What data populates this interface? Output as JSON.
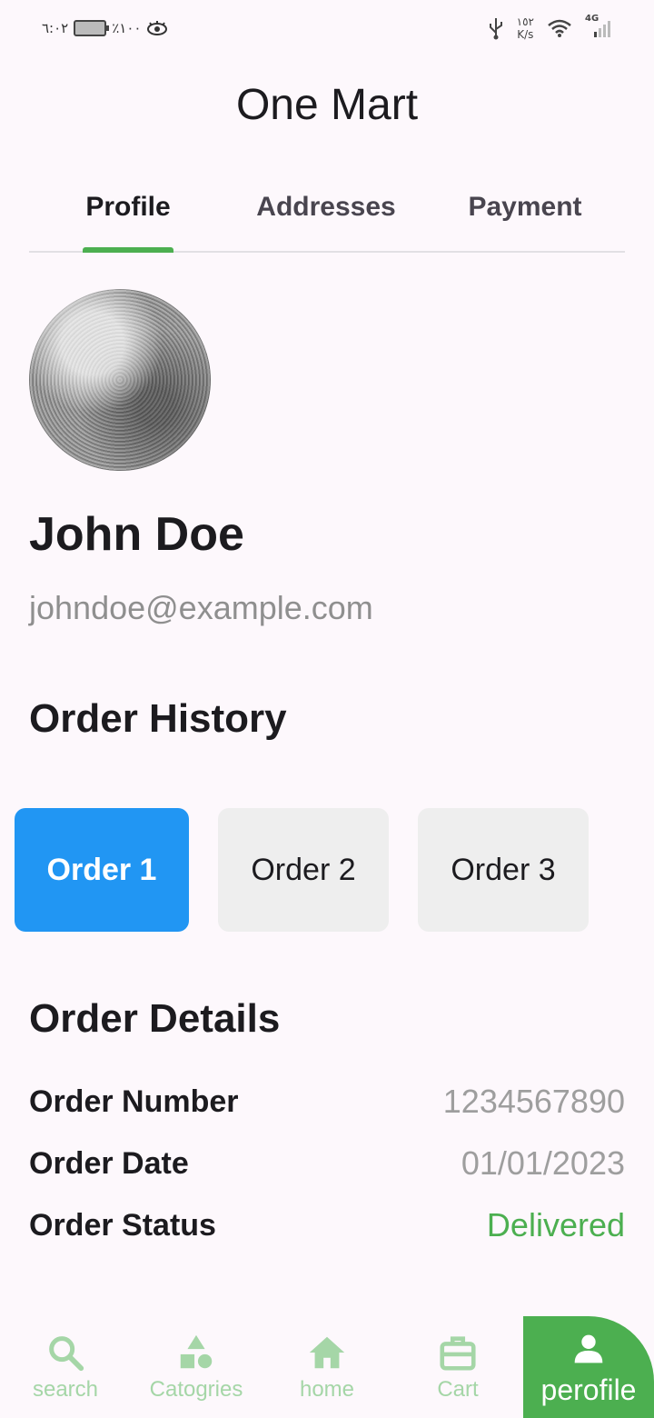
{
  "status_bar": {
    "time": "٦:٠٢",
    "battery": "٪١٠٠",
    "speed_value": "١٥٢",
    "speed_unit": "K/s",
    "network": "4G"
  },
  "app": {
    "title": "One Mart"
  },
  "tabs": [
    {
      "label": "Profile",
      "active": true
    },
    {
      "label": "Addresses",
      "active": false
    },
    {
      "label": "Payment",
      "active": false
    }
  ],
  "profile": {
    "name": "John Doe",
    "email": "johndoe@example.com"
  },
  "order_history": {
    "title": "Order History",
    "orders": [
      {
        "label": "Order 1",
        "selected": true
      },
      {
        "label": "Order 2",
        "selected": false
      },
      {
        "label": "Order 3",
        "selected": false
      }
    ]
  },
  "order_details": {
    "title": "Order Details",
    "rows": [
      {
        "label": "Order Number",
        "value": "1234567890"
      },
      {
        "label": "Order Date",
        "value": "01/01/2023"
      },
      {
        "label": "Order Status",
        "value": "Delivered"
      }
    ]
  },
  "bottom_nav": [
    {
      "label": "search",
      "icon": "search-icon"
    },
    {
      "label": "Catogries",
      "icon": "categories-icon"
    },
    {
      "label": "home",
      "icon": "home-icon"
    },
    {
      "label": "Cart",
      "icon": "cart-icon"
    },
    {
      "label": "perofile",
      "icon": "person-icon",
      "active": true
    }
  ],
  "colors": {
    "accent_green": "#4caf50",
    "light_green": "#a5d6a7",
    "selected_blue": "#2196f3",
    "background": "#fdf8fc"
  }
}
